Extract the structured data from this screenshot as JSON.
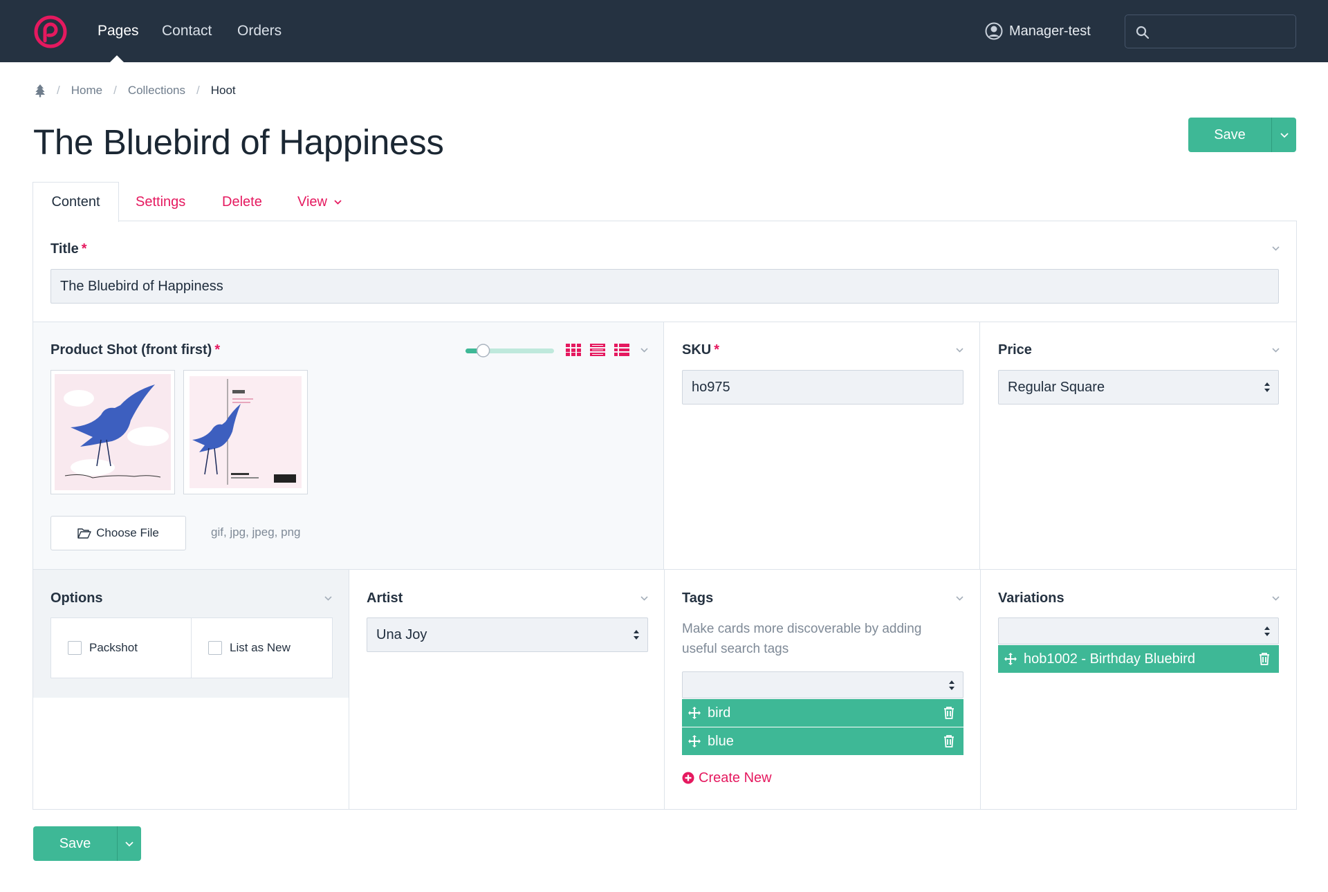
{
  "nav": {
    "links": [
      "Pages",
      "Contact",
      "Orders"
    ],
    "user": "Manager-test",
    "search_placeholder": ""
  },
  "breadcrumb": [
    "Home",
    "Collections",
    "Hoot"
  ],
  "page_title": "The Bluebird of Happiness",
  "save_label": "Save",
  "tabs": {
    "content": "Content",
    "settings": "Settings",
    "delete": "Delete",
    "view": "View"
  },
  "fields": {
    "title": {
      "label": "Title",
      "value": "The Bluebird of Happiness"
    },
    "product_shot": {
      "label": "Product Shot (front first)",
      "choose_file": "Choose File",
      "file_types": "gif, jpg, jpeg, png",
      "thumb_size_level": 0.2
    },
    "sku": {
      "label": "SKU",
      "value": "ho975"
    },
    "price": {
      "label": "Price",
      "value": "Regular Square"
    },
    "options": {
      "label": "Options",
      "checkboxes": [
        "Packshot",
        "List as New"
      ]
    },
    "artist": {
      "label": "Artist",
      "value": "Una Joy"
    },
    "tags": {
      "label": "Tags",
      "help": "Make cards more discoverable by adding useful search tags",
      "items": [
        "bird",
        "blue"
      ],
      "create_new": "Create New"
    },
    "variations": {
      "label": "Variations",
      "items": [
        "hob1002 - Birthday Bluebird"
      ]
    }
  },
  "colors": {
    "brand": "#e5195f",
    "accent": "#3eb896",
    "navbar": "#253241"
  }
}
